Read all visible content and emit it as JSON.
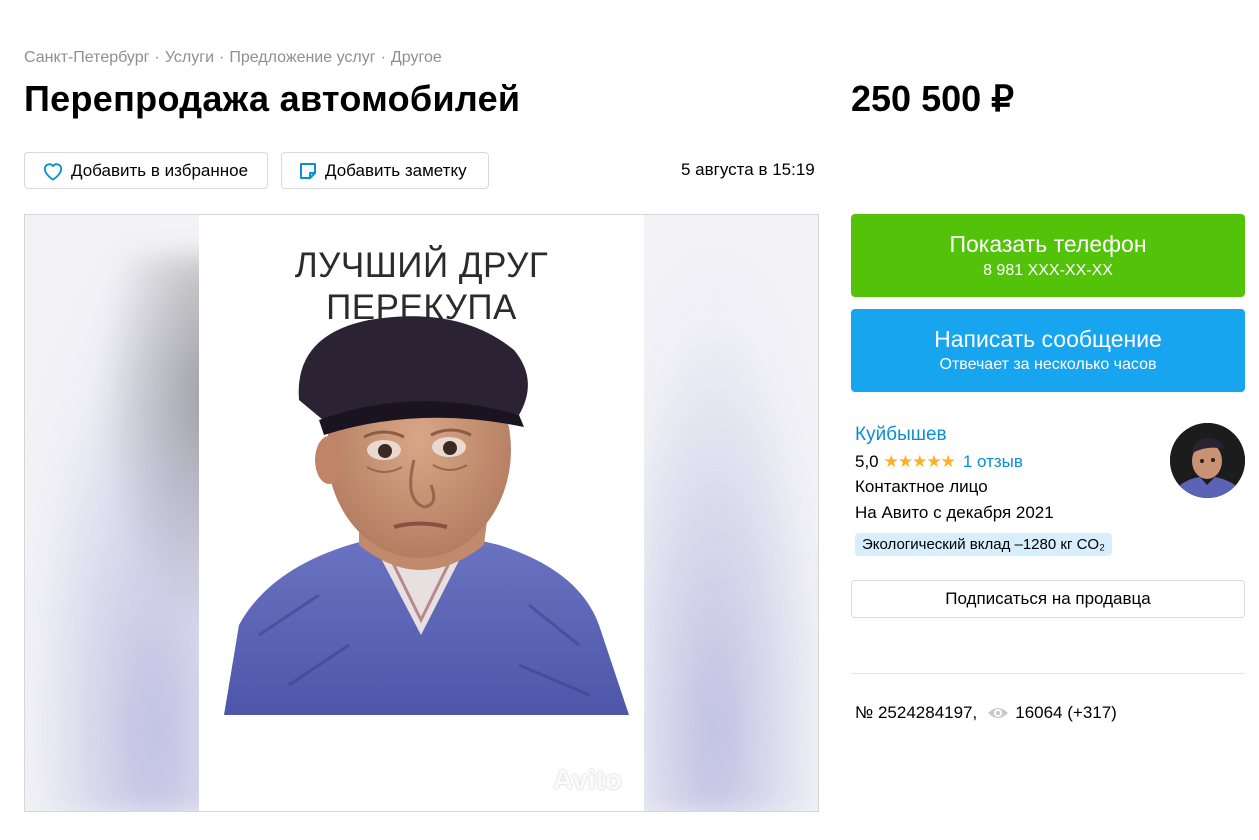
{
  "breadcrumb": {
    "items": [
      "Санкт-Петербург",
      "Услуги",
      "Предложение услуг",
      "Другое"
    ],
    "separator": "·"
  },
  "listing": {
    "title": "Перепродажа автомобилей",
    "price": "250 500 ₽",
    "date": "5 августа в 15:19",
    "number": "№ 2524284197,",
    "views": "16064 (+317)"
  },
  "actions": {
    "favorite_label": "Добавить в избранное",
    "note_label": "Добавить заметку",
    "phone_label": "Показать телефон",
    "phone_number": "8 981 XXX-XX-XX",
    "message_label": "Написать сообщение",
    "message_sub": "Отвечает за несколько часов",
    "subscribe_label": "Подписаться на продавца"
  },
  "photo": {
    "caption_line1": "ЛУЧШИЙ ДРУГ",
    "caption_line2": "ПЕРЕКУПА",
    "watermark": "Avito"
  },
  "seller": {
    "name": "Куйбышев",
    "rating": "5,0",
    "stars": "★★★★★",
    "reviews": "1 отзыв",
    "role": "Контактное лицо",
    "since": "На Авито с декабря 2021",
    "eco": "Экологический вклад –1280 кг CO₂"
  },
  "icons": {
    "favorite": "heart-icon",
    "note": "note-icon",
    "views": "eye-icon"
  },
  "colors": {
    "phone_button": "#53c30a",
    "message_button": "#17a5f0",
    "link": "#0a8ed6",
    "stars": "#ffb021",
    "eco_badge": "#d7eefc"
  }
}
